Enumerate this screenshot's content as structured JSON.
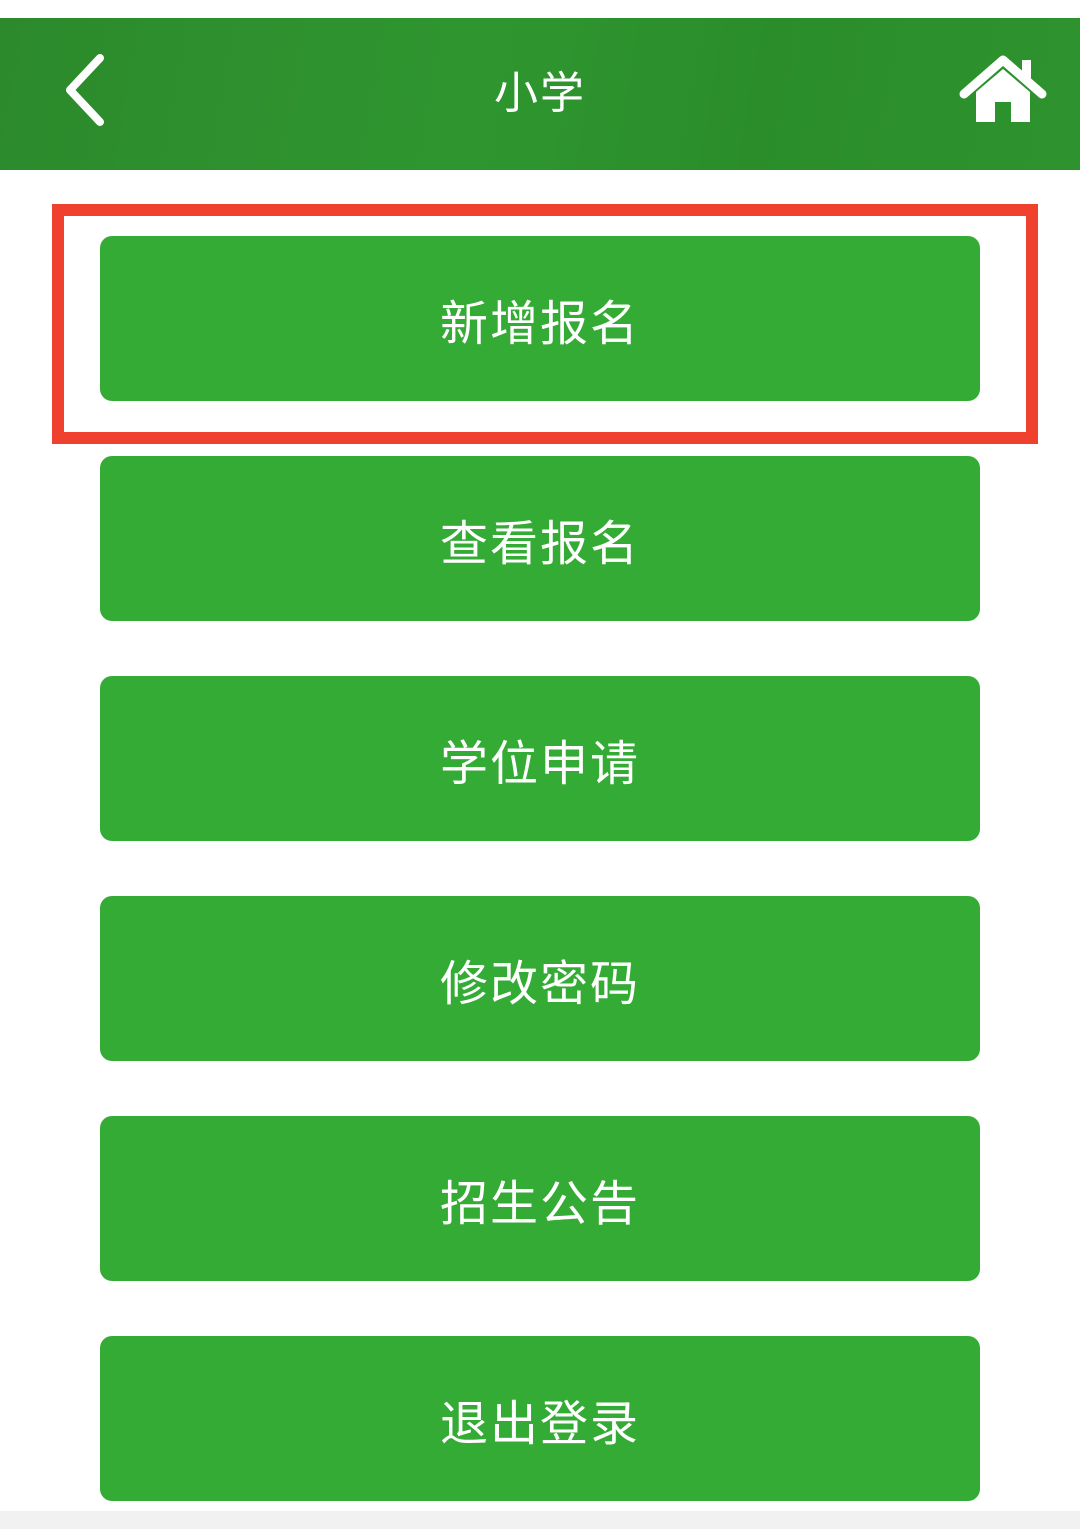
{
  "header": {
    "title": "小学",
    "back_icon": "chevron-left-icon",
    "home_icon": "home-icon"
  },
  "colors": {
    "header_green": "#2e912e",
    "button_green": "#34ab34",
    "highlight_red": "#f0412f",
    "text_white": "#ffffff"
  },
  "menu": {
    "items": [
      {
        "label": "新增报名",
        "highlighted": true
      },
      {
        "label": "查看报名",
        "highlighted": false
      },
      {
        "label": "学位申请",
        "highlighted": false
      },
      {
        "label": "修改密码",
        "highlighted": false
      },
      {
        "label": "招生公告",
        "highlighted": false
      },
      {
        "label": "退出登录",
        "highlighted": false
      }
    ]
  }
}
